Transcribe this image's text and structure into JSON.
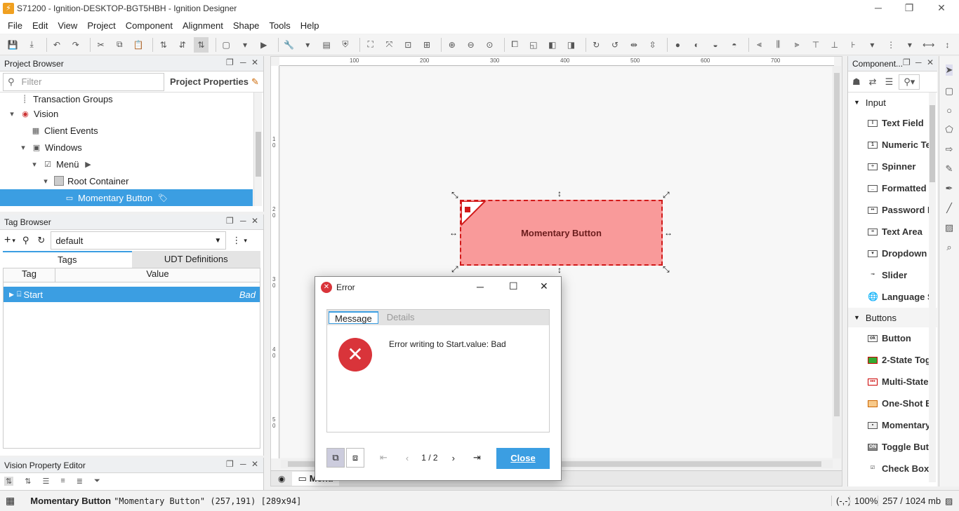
{
  "window": {
    "title": "S71200 - Ignition-DESKTOP-BGT5HBH - Ignition Designer",
    "logo": "ignition-logo"
  },
  "menu": [
    "File",
    "Edit",
    "View",
    "Project",
    "Component",
    "Alignment",
    "Shape",
    "Tools",
    "Help"
  ],
  "project_browser": {
    "title": "Project Browser",
    "filter_placeholder": "Filter",
    "properties_label": "Project Properties",
    "tree": [
      {
        "label": "Transaction Groups",
        "depth": 1
      },
      {
        "label": "Vision",
        "depth": 0
      },
      {
        "label": "Client Events",
        "depth": 2
      },
      {
        "label": "Windows",
        "depth": 1
      },
      {
        "label": "Menü",
        "depth": 2
      },
      {
        "label": "Root Container",
        "depth": 3
      },
      {
        "label": "Momentary Button",
        "depth": 4,
        "selected": true
      }
    ]
  },
  "tag_browser": {
    "title": "Tag Browser",
    "provider": "default",
    "tabs": [
      "Tags",
      "UDT Definitions"
    ],
    "columns": [
      "Tag",
      "Value"
    ],
    "rows": [
      {
        "tag": "Start",
        "value": "Bad"
      }
    ]
  },
  "property_editor": {
    "title": "Vision Property Editor"
  },
  "canvas": {
    "ruler_top": [
      "100",
      "200",
      "300",
      "400",
      "500",
      "600",
      "700"
    ],
    "ruler_left": [
      "1 0",
      "2 0",
      "3 0",
      "4 0",
      "5 0"
    ],
    "button_label": "Momentary Button",
    "tab_label": "Menü"
  },
  "palette": {
    "title": "Component...",
    "categories": [
      {
        "name": "Input",
        "items": [
          "Text Field",
          "Numeric Te",
          "Spinner",
          "Formatted",
          "Password F",
          "Text Area",
          "Dropdown",
          "Slider",
          "Language S"
        ]
      },
      {
        "name": "Buttons",
        "items": [
          "Button",
          "2-State Tog",
          "Multi-State",
          "One-Shot B",
          "Momentary",
          "Toggle Butt",
          "Check Box"
        ]
      }
    ]
  },
  "error_dialog": {
    "title": "Error",
    "tabs": [
      "Message",
      "Details"
    ],
    "message": "Error writing to Start.value: Bad",
    "pager": "1 / 2",
    "close_label": "Close"
  },
  "status": {
    "selection_name": "Momentary Button",
    "selection_detail": "\"Momentary Button\" (257,191) [289x94]",
    "coords": "(-,-)",
    "zoom": "100%",
    "memory": "257 / 1024 mb"
  },
  "colors": {
    "accent": "#3b9ee2",
    "button_fill": "#f99a9a",
    "button_border": "#d11a1a",
    "error_red": "#d9343a"
  }
}
